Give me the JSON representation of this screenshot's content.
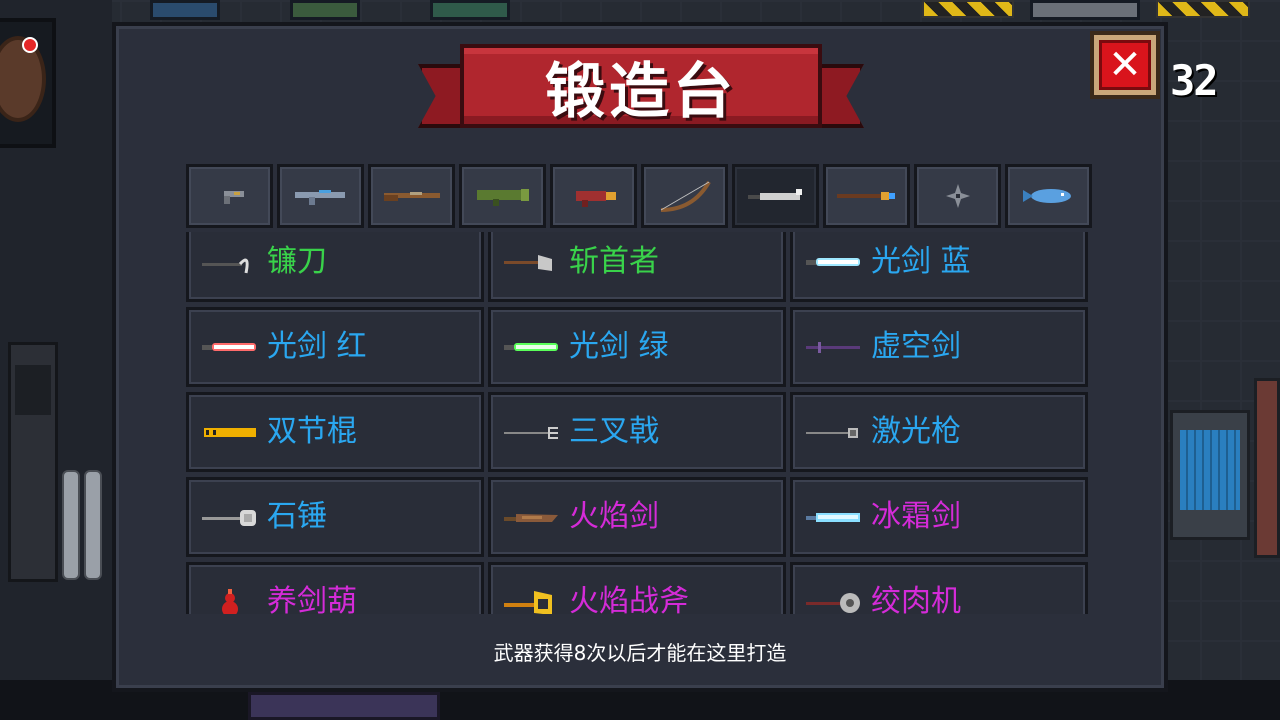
{
  "panel": {
    "title": "锻造台",
    "close_label": "✕",
    "gem_count": "32",
    "hint": "武器获得8次以后才能在这里打造"
  },
  "tabs": [
    {
      "icon": "pistol-icon",
      "active": false
    },
    {
      "icon": "rifle-icon",
      "active": false
    },
    {
      "icon": "shotgun-icon",
      "active": false
    },
    {
      "icon": "launcher-icon",
      "active": false
    },
    {
      "icon": "blaster-icon",
      "active": false
    },
    {
      "icon": "bow-icon",
      "active": false
    },
    {
      "icon": "melee-blade-icon",
      "active": true
    },
    {
      "icon": "staff-icon",
      "active": false
    },
    {
      "icon": "shuriken-icon",
      "active": false
    },
    {
      "icon": "fish-icon",
      "active": false
    }
  ],
  "weapons": [
    {
      "name": "镰刀",
      "color": "#39d24a",
      "icon": "scythe-icon"
    },
    {
      "name": "斩首者",
      "color": "#39d24a",
      "icon": "axe-icon"
    },
    {
      "name": "光剑 蓝",
      "color": "#2aa7f0",
      "icon": "lightsaber-blue-icon"
    },
    {
      "name": "光剑 红",
      "color": "#2aa7f0",
      "icon": "lightsaber-red-icon"
    },
    {
      "name": "光剑 绿",
      "color": "#2aa7f0",
      "icon": "lightsaber-green-icon"
    },
    {
      "name": "虚空剑",
      "color": "#2aa7f0",
      "icon": "void-sword-icon"
    },
    {
      "name": "双节棍",
      "color": "#2aa7f0",
      "icon": "nunchaku-icon"
    },
    {
      "name": "三叉戟",
      "color": "#2aa7f0",
      "icon": "trident-icon"
    },
    {
      "name": "激光枪",
      "color": "#2aa7f0",
      "icon": "laser-spear-icon"
    },
    {
      "name": "石锤",
      "color": "#2aa7f0",
      "icon": "stone-hammer-icon"
    },
    {
      "name": "火焰剑",
      "color": "#d42bd8",
      "icon": "flame-sword-icon"
    },
    {
      "name": "冰霜剑",
      "color": "#d42bd8",
      "icon": "frost-sword-icon"
    },
    {
      "name": "养剑葫",
      "color": "#d42bd8",
      "icon": "gourd-icon"
    },
    {
      "name": "火焰战斧",
      "color": "#d42bd8",
      "icon": "flame-battleaxe-icon"
    },
    {
      "name": "绞肉机",
      "color": "#d42bd8",
      "icon": "meat-grinder-icon"
    }
  ]
}
